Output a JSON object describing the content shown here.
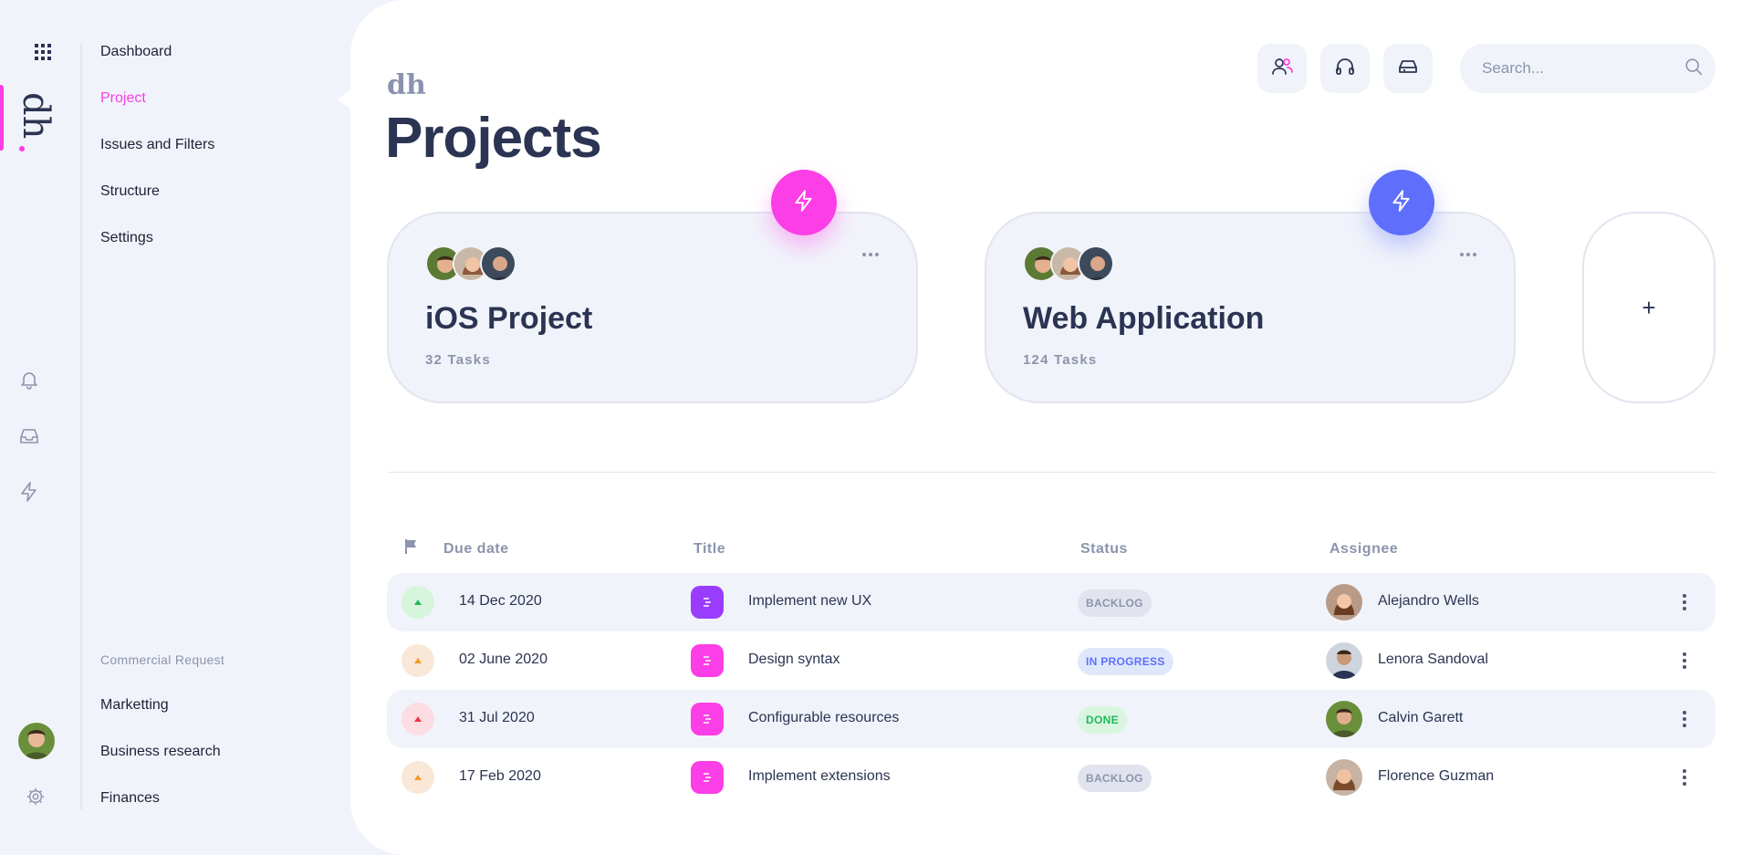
{
  "rail": {
    "logo": "dh",
    "icons": [
      "apps-grid-icon",
      "bell-icon",
      "inbox-icon",
      "bolt-icon",
      "gear-icon"
    ]
  },
  "nav": {
    "items": [
      "Dashboard",
      "Project",
      "Issues and Filters",
      "Structure",
      "Settings"
    ],
    "active": "Project",
    "section_title": "Commercial Request",
    "section_items": [
      "Marketting",
      "Business research",
      "Finances"
    ]
  },
  "header": {
    "brand": "dh",
    "title": "Projects",
    "search_placeholder": "Search...",
    "buttons": [
      "users-icon",
      "headphones-icon",
      "inbox-icon"
    ]
  },
  "projects": [
    {
      "name": "iOS Project",
      "tasks": "32 Tasks",
      "accent": "#fc3ee6"
    },
    {
      "name": "Web Application",
      "tasks": "124 Tasks",
      "accent": "#5f6ffc"
    }
  ],
  "add_project": "+",
  "table": {
    "headers": {
      "due": "Due date",
      "title": "Title",
      "status": "Status",
      "assignee": "Assignee"
    },
    "rows": [
      {
        "date": "14 Dec 2020",
        "title": "Implement new UX",
        "status": "BACKLOG",
        "assignee": "Alejandro Wells",
        "priority": "low",
        "icon_color": "#9a3cfc"
      },
      {
        "date": "02 June 2020",
        "title": "Design syntax",
        "status": "IN PROGRESS",
        "assignee": "Lenora Sandoval",
        "priority": "medium",
        "icon_color": "#fc3ee6"
      },
      {
        "date": "31 Jul 2020",
        "title": "Configurable resources",
        "status": "DONE",
        "assignee": "Calvin Garett",
        "priority": "high",
        "icon_color": "#fc3ee6"
      },
      {
        "date": "17 Feb 2020",
        "title": "Implement extensions",
        "status": "BACKLOG",
        "assignee": "Florence Guzman",
        "priority": "medium",
        "icon_color": "#fc3ee6"
      }
    ]
  },
  "colors": {
    "accent_pink": "#fc3ee6",
    "accent_blue": "#5f6ffc",
    "text_dark": "#2b3452",
    "text_muted": "#8c94ad"
  }
}
